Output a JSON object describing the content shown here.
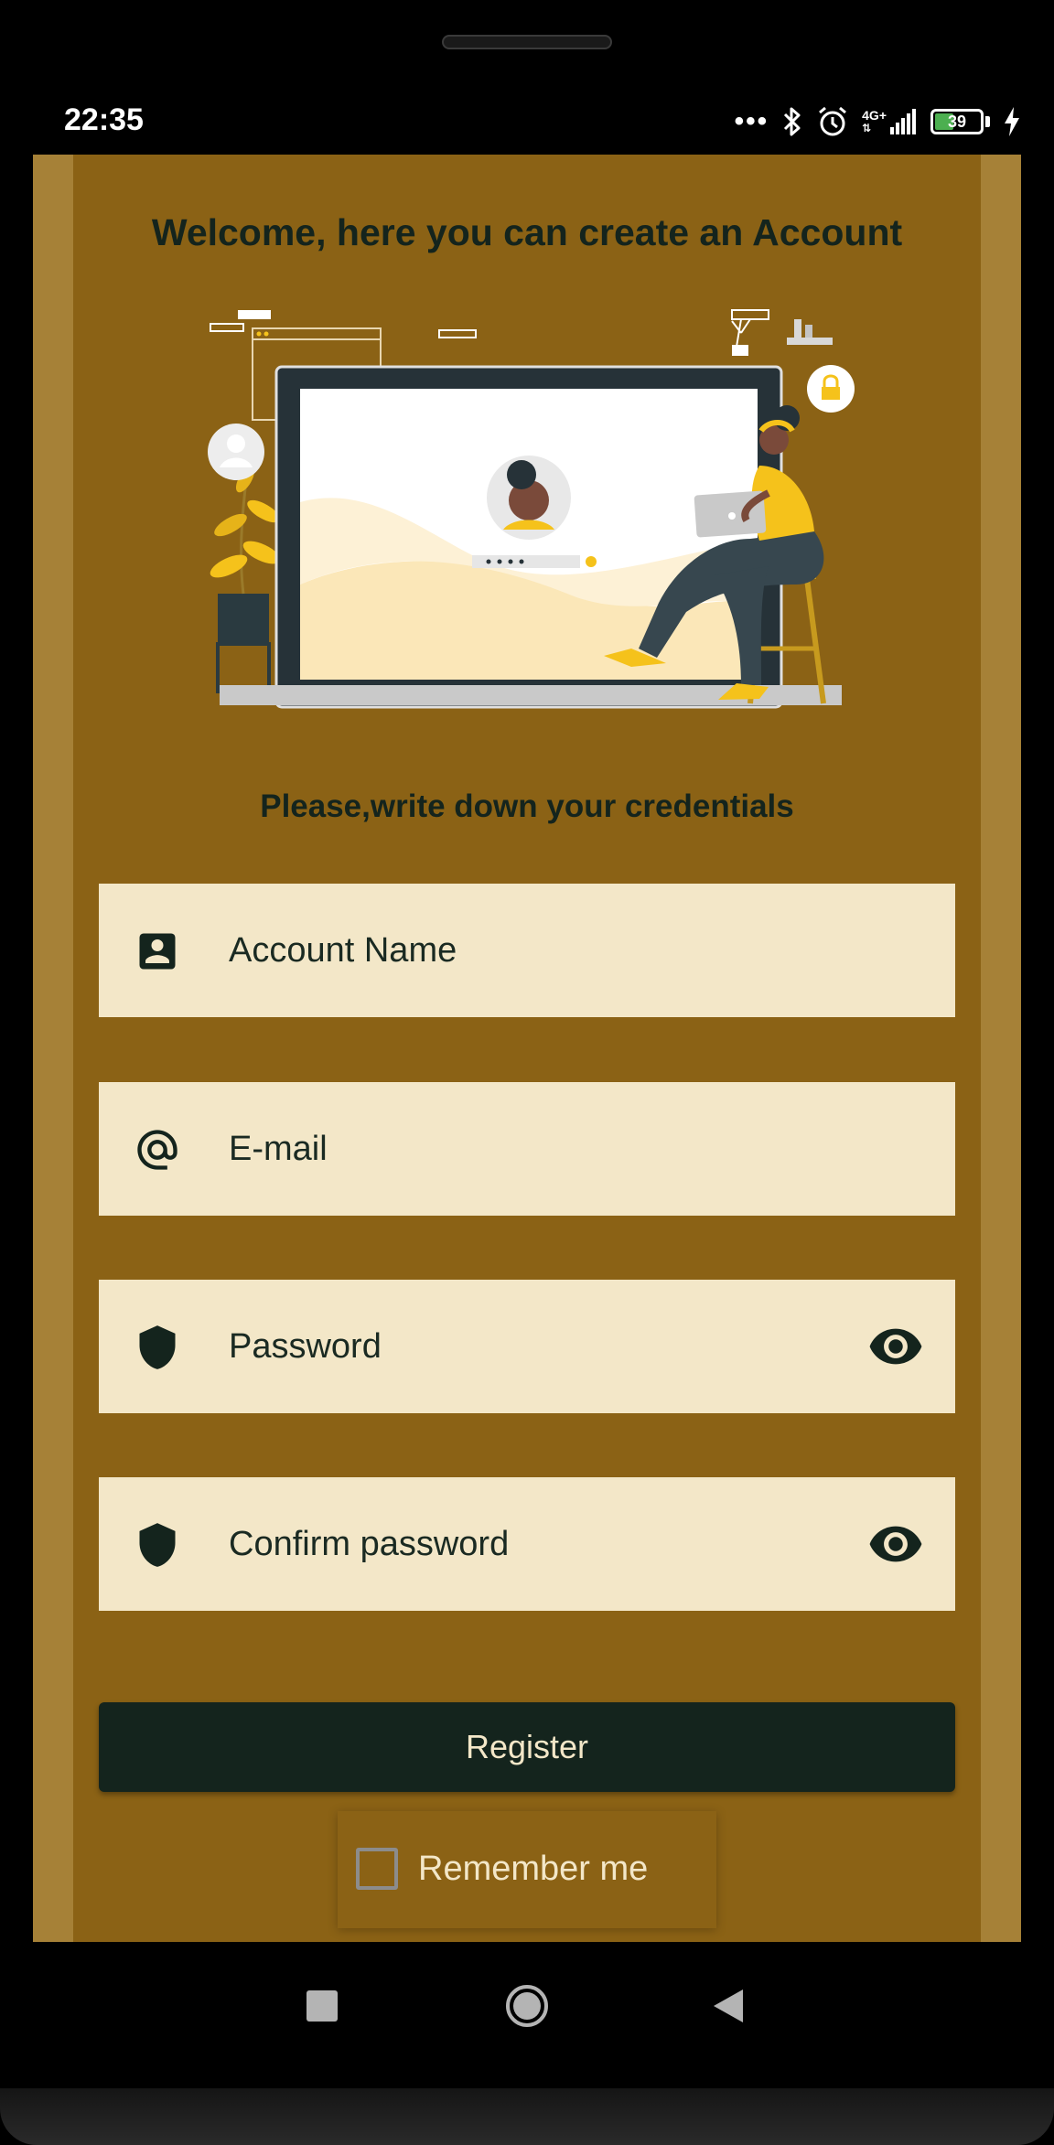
{
  "status_bar": {
    "time": "22:35",
    "network": "4G+",
    "battery_level": "39",
    "icons": [
      "more-dots-icon",
      "bluetooth-icon",
      "alarm-icon",
      "signal-icon",
      "battery-icon",
      "charging-icon"
    ]
  },
  "screen": {
    "heading": "Welcome, here you can create an Account",
    "subheading": "Please,write down your credentials",
    "fields": {
      "account_name": {
        "placeholder": "Account Name",
        "value": "",
        "icon": "account-box-icon"
      },
      "email": {
        "placeholder": "E-mail",
        "value": "",
        "icon": "at-sign-icon"
      },
      "password": {
        "placeholder": "Password",
        "value": "",
        "icon": "shield-icon",
        "toggle_icon": "eye-icon"
      },
      "confirm_password": {
        "placeholder": "Confirm password",
        "value": "",
        "icon": "shield-icon",
        "toggle_icon": "eye-icon"
      }
    },
    "register_label": "Register",
    "remember_me": {
      "label": "Remember me",
      "checked": false
    }
  },
  "colors": {
    "background": "#8b6215",
    "side_stripe": "#a68137",
    "field_bg": "#f3e7c8",
    "dark": "#14241d",
    "accent_yellow": "#f5c21b"
  },
  "nav_bar": {
    "icons": [
      "recents-square-icon",
      "home-circle-icon",
      "back-triangle-icon"
    ]
  }
}
